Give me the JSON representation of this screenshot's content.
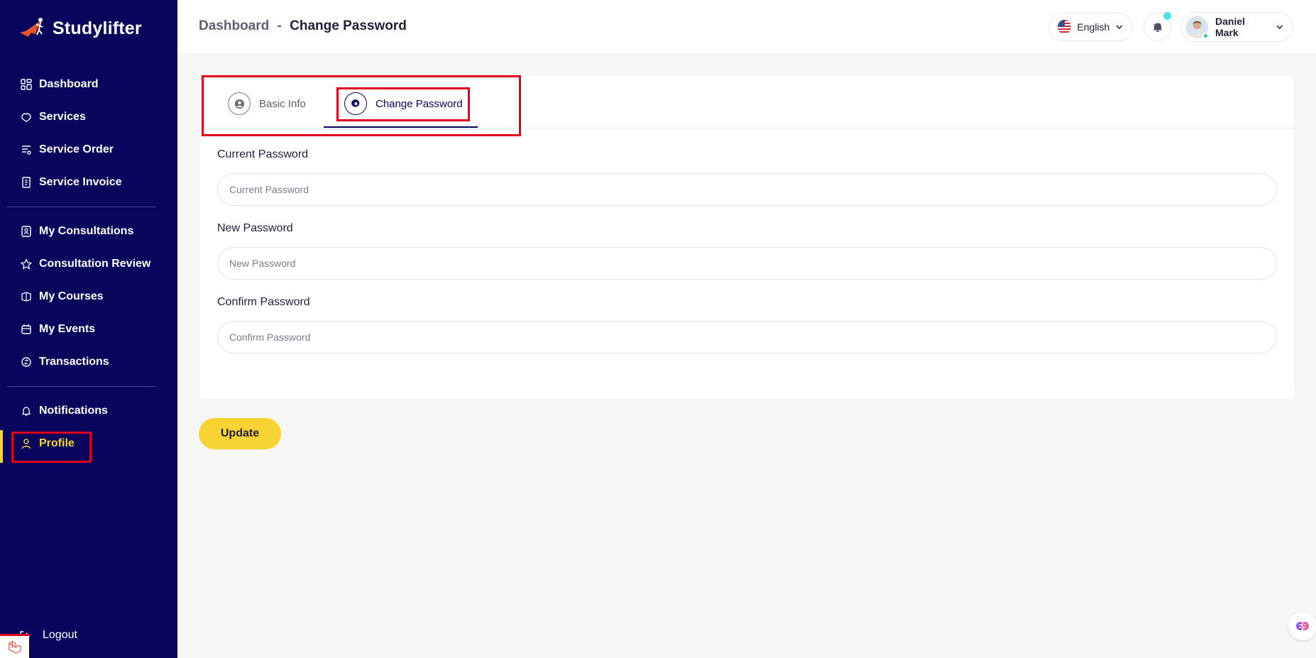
{
  "app": {
    "name": "Studylifter"
  },
  "sidebar": {
    "groups": [
      [
        {
          "label": "Dashboard",
          "icon": "dashboard-icon"
        },
        {
          "label": "Services",
          "icon": "services-icon"
        },
        {
          "label": "Service Order",
          "icon": "service-order-icon"
        },
        {
          "label": "Service Invoice",
          "icon": "invoice-icon"
        }
      ],
      [
        {
          "label": "My Consultations",
          "icon": "consultations-icon"
        },
        {
          "label": "Consultation Review",
          "icon": "star-icon"
        },
        {
          "label": "My Courses",
          "icon": "courses-icon"
        },
        {
          "label": "My Events",
          "icon": "events-icon"
        },
        {
          "label": "Transactions",
          "icon": "transactions-icon"
        }
      ],
      [
        {
          "label": "Notifications",
          "icon": "bell-icon"
        },
        {
          "label": "Profile",
          "icon": "user-icon",
          "active": true
        }
      ]
    ],
    "logout_label": "Logout"
  },
  "header": {
    "breadcrumb_root": "Dashboard",
    "breadcrumb_sep": "-",
    "breadcrumb_current": "Change Password",
    "language": "English",
    "user_name": "Daniel Mark"
  },
  "tabs": {
    "basic_info": "Basic Info",
    "change_password": "Change Password",
    "active": "change_password"
  },
  "form": {
    "current_password": {
      "label": "Current Password",
      "placeholder": "Current Password"
    },
    "new_password": {
      "label": "New Password",
      "placeholder": "New Password"
    },
    "confirm_password": {
      "label": "Confirm Password",
      "placeholder": "Confirm Password"
    },
    "submit_label": "Update"
  },
  "colors": {
    "sidebar_bg": "#07055c",
    "accent_yellow": "#f7d433",
    "highlight_red": "#e0001b",
    "notification_dot": "#4de2e7"
  }
}
